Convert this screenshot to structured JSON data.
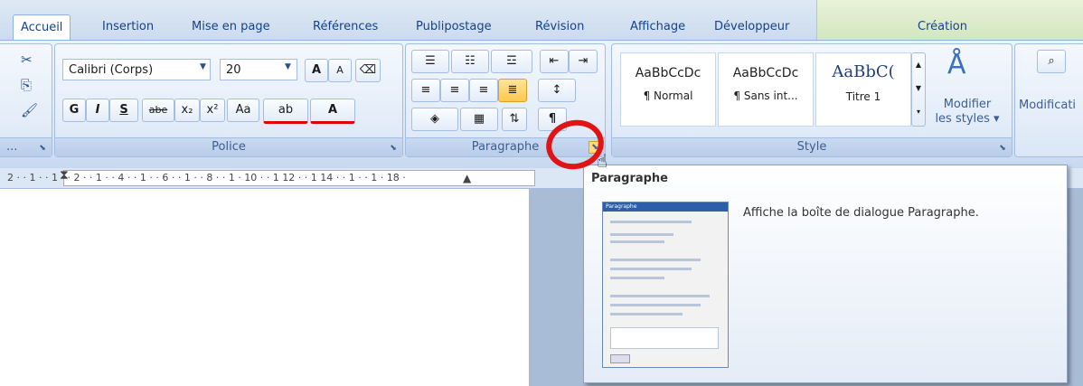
{
  "tabs": [
    {
      "label": "Accueil",
      "active": true
    },
    {
      "label": "Insertion"
    },
    {
      "label": "Mise en page"
    },
    {
      "label": "Références"
    },
    {
      "label": "Publipostage"
    },
    {
      "label": "Révision"
    },
    {
      "label": "Affichage"
    },
    {
      "label": "Développeur"
    },
    {
      "label": "Création"
    }
  ],
  "clipboard": {
    "label": "..."
  },
  "police": {
    "label": "Police",
    "font_name": "Calibri (Corps)",
    "font_size": "20",
    "grow": "A",
    "shrink": "A",
    "bold": "G",
    "italic": "I",
    "underline": "S",
    "strike": "abe",
    "subscript": "x₂",
    "superscript": "x²",
    "case": "Aa",
    "highlight": "ab",
    "fontcolor": "A"
  },
  "paragraphe": {
    "label": "Paragraphe",
    "pilcrow": "¶"
  },
  "style": {
    "label": "Style",
    "items": [
      {
        "sample": "AaBbCcDc",
        "name": "¶ Normal"
      },
      {
        "sample": "AaBbCcDc",
        "name": "¶ Sans int..."
      },
      {
        "sample": "AaBbC(",
        "name": "Titre 1"
      }
    ],
    "modify_line1": "Modifier",
    "modify_line2": "les styles ▾"
  },
  "editing": {
    "label": "Modificati"
  },
  "ruler": {
    "text": "2 · · 1 · · 1 · · 2 · · 1 · · 4 · · 1 · · 6 · · 1 · · 8 · · 1 · 10 · · 1 12 · · 1 14 · · 1 · · 1 · 18 ·"
  },
  "tooltip": {
    "title": "Paragraphe",
    "description": "Affiche la boîte de dialogue Paragraphe.",
    "thumb_title": "Paragraphe"
  },
  "colors": {
    "accent": "#15428b",
    "highlight_circle": "#e01414"
  }
}
